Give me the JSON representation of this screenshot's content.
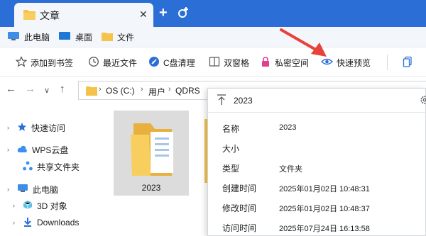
{
  "tab": {
    "title": "文章",
    "close": "✕",
    "new_tab": "+"
  },
  "quickbar": {
    "items": [
      "此电脑",
      "桌面",
      "文件"
    ]
  },
  "toolbar": {
    "bookmark": "添加到书签",
    "recent": "最近文件",
    "clean": "C盘清理",
    "dual": "双窗格",
    "private": "私密空间",
    "preview": "快速预览"
  },
  "address": {
    "crumbs": [
      "OS (C:)",
      "用户",
      "QDRS"
    ]
  },
  "sidebar": {
    "items": [
      "快速访问",
      "WPS云盘",
      "共享文件夹",
      "此电脑",
      "3D 对象",
      "Downloads"
    ]
  },
  "content": {
    "items": [
      {
        "name": "2023",
        "type": "folder"
      }
    ]
  },
  "details": {
    "title": "2023",
    "rows": [
      {
        "key": "名称",
        "value": "2023"
      },
      {
        "key": "大小",
        "value": ""
      },
      {
        "key": "类型",
        "value": "文件夹"
      },
      {
        "key": "创建时间",
        "value": "2025年01月02日  10:48:31"
      },
      {
        "key": "修改时间",
        "value": "2025年01月02日  10:48:37"
      },
      {
        "key": "访问时间",
        "value": "2025年07月24日  16:13:58"
      }
    ]
  },
  "colors": {
    "accent": "#2b6fd6",
    "folder": "#f5c34a",
    "annotation": "#e8413a"
  }
}
